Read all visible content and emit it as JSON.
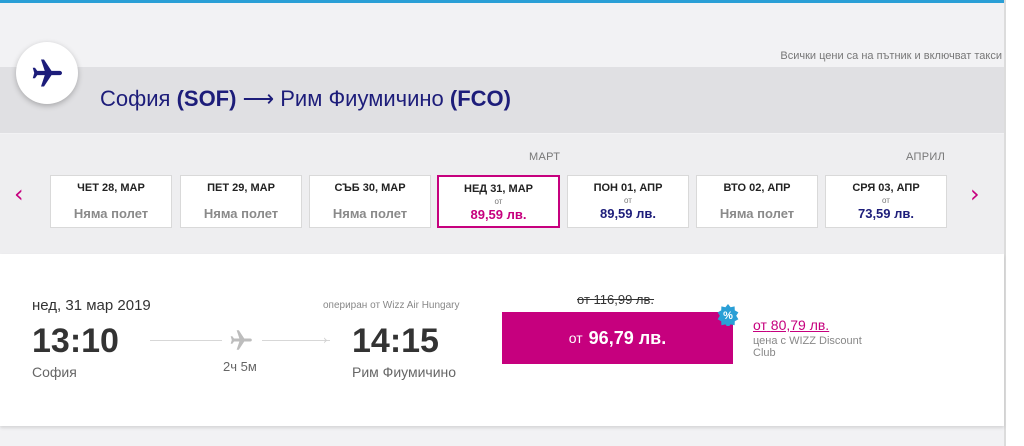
{
  "header": {
    "prices_note": "Всички цени са на пътник и включват такси"
  },
  "route": {
    "origin_city": "София",
    "origin_code": "(SOF)",
    "arrow": "⟶",
    "destination_city": "Рим Фиумичино",
    "destination_code": "(FCO)"
  },
  "months": {
    "march": "МАРТ",
    "april": "АПРИЛ"
  },
  "nav": {
    "prev": "‹",
    "next": "›"
  },
  "dates": [
    {
      "label": "ЧЕТ 28, МАР",
      "status": "Няма полет",
      "from": "",
      "price": ""
    },
    {
      "label": "ПЕТ 29, МАР",
      "status": "Няма полет",
      "from": "",
      "price": ""
    },
    {
      "label": "СЪБ 30, МАР",
      "status": "Няма полет",
      "from": "",
      "price": ""
    },
    {
      "label": "НЕД 31, МАР",
      "status": "",
      "from": "от",
      "price": "89,59 лв."
    },
    {
      "label": "ПОН 01, АПР",
      "status": "",
      "from": "от",
      "price": "89,59 лв."
    },
    {
      "label": "ВТО 02, АПР",
      "status": "Няма полет",
      "from": "",
      "price": ""
    },
    {
      "label": "СРЯ 03, АПР",
      "status": "",
      "from": "от",
      "price": "73,59 лв."
    }
  ],
  "flight": {
    "date": "нед, 31 мар 2019",
    "operator": "опериран от Wizz Air Hungary",
    "depart_time": "13:10",
    "depart_city": "София",
    "arrive_time": "14:15",
    "arrive_city": "Рим Фиумичино",
    "duration": "2ч 5м",
    "old_price": "от 116,99 лв.",
    "price_prefix": "от",
    "price": "96,79 лв.",
    "discount_badge": "%",
    "club_prefix": "от",
    "club_price": "80,79 лв.",
    "club_text": "цена с WIZZ Discount Club"
  },
  "colors": {
    "brand_magenta": "#c6007e",
    "brand_navy": "#1d1d7a",
    "accent_blue": "#2a9fd6"
  }
}
